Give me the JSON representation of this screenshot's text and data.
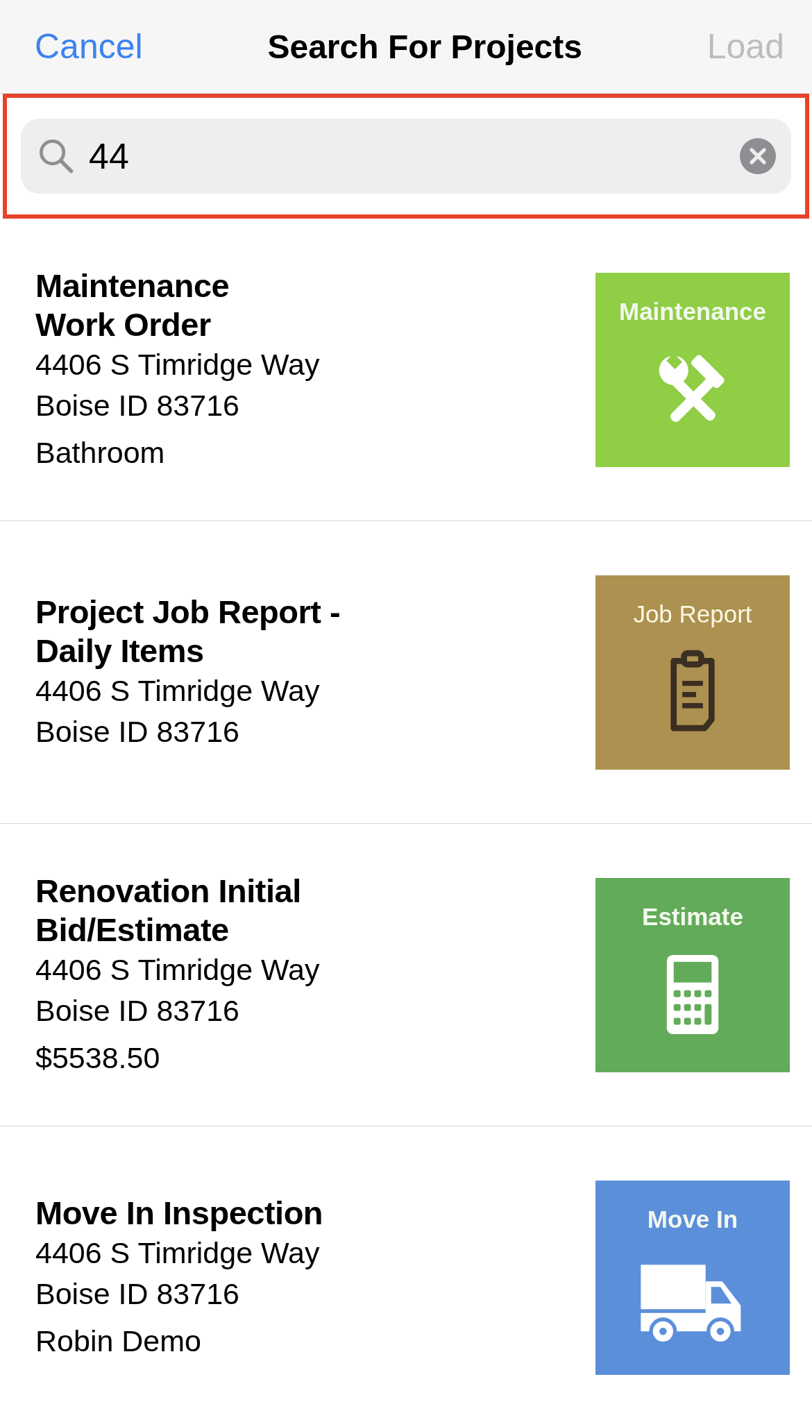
{
  "nav": {
    "cancel": "Cancel",
    "title": "Search For Projects",
    "load": {
      "label": "Load",
      "disabled": true
    }
  },
  "search": {
    "value": "44",
    "highlighted": true
  },
  "projects": [
    {
      "title_lines": [
        "Maintenance",
        "Work Order"
      ],
      "address": [
        "4406 S Timridge Way",
        "Boise ID 83716"
      ],
      "note": "Bathroom",
      "thumbnail": {
        "kind": "maintenance",
        "label": "Maintenance",
        "color": "#8fce45"
      }
    },
    {
      "title_lines": [
        "Project Job Report -",
        "Daily Items"
      ],
      "address": [
        "4406 S Timridge Way",
        "Boise ID 83716"
      ],
      "thumbnail": {
        "kind": "job_report",
        "label": "Job Report",
        "color": "#ad9150"
      }
    },
    {
      "title_lines": [
        "Renovation Initial",
        "Bid/Estimate"
      ],
      "address": [
        "4406 S Timridge Way",
        "Boise ID 83716"
      ],
      "note": "$5538.50",
      "thumbnail": {
        "kind": "estimate",
        "label": "Estimate",
        "color": "#62ab5a"
      }
    },
    {
      "title_lines": [
        "Move In Inspection"
      ],
      "address": [
        "4406 S Timridge Way",
        "Boise ID 83716"
      ],
      "note": "Robin Demo",
      "thumbnail": {
        "kind": "move_in",
        "label": "Move In",
        "color": "#5b8fd9"
      }
    }
  ]
}
